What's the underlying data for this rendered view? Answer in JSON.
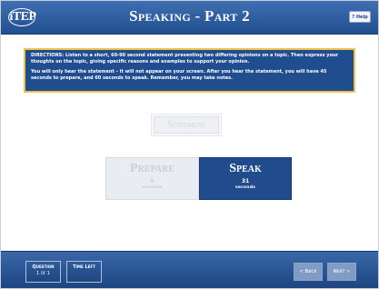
{
  "header": {
    "logo": "iTEP",
    "title": "Speaking - Part 2",
    "help_label": "? Help"
  },
  "directions": {
    "paragraph1": "DIRECTIONS:  Listen to a short, 60-90 second statement presenting two differing opinions on a topic.  Then express your thoughts on the topic, giving specific reasons and examples to support your opinion.",
    "paragraph2": "You will only hear the statement – it will not appear on your screen.  After you hear the statement, you will have 45 seconds to prepare, and 60 seconds to speak.  Remember, you may take notes."
  },
  "statement_button": {
    "label": "Statement"
  },
  "prepare": {
    "label": "Prepare",
    "value": "0",
    "unit": "seconds"
  },
  "speak": {
    "label": "Speak",
    "value": "31",
    "unit": "seconds"
  },
  "footer": {
    "question_label": "Question",
    "question_value": "1 of 1",
    "time_left_label": "Time Left",
    "back_label": "< Back",
    "next_label": "Next >"
  },
  "colors": {
    "primary_blue": "#204c8d",
    "accent_gold": "#f0c24a",
    "disabled_gray": "#e9ecf1"
  }
}
